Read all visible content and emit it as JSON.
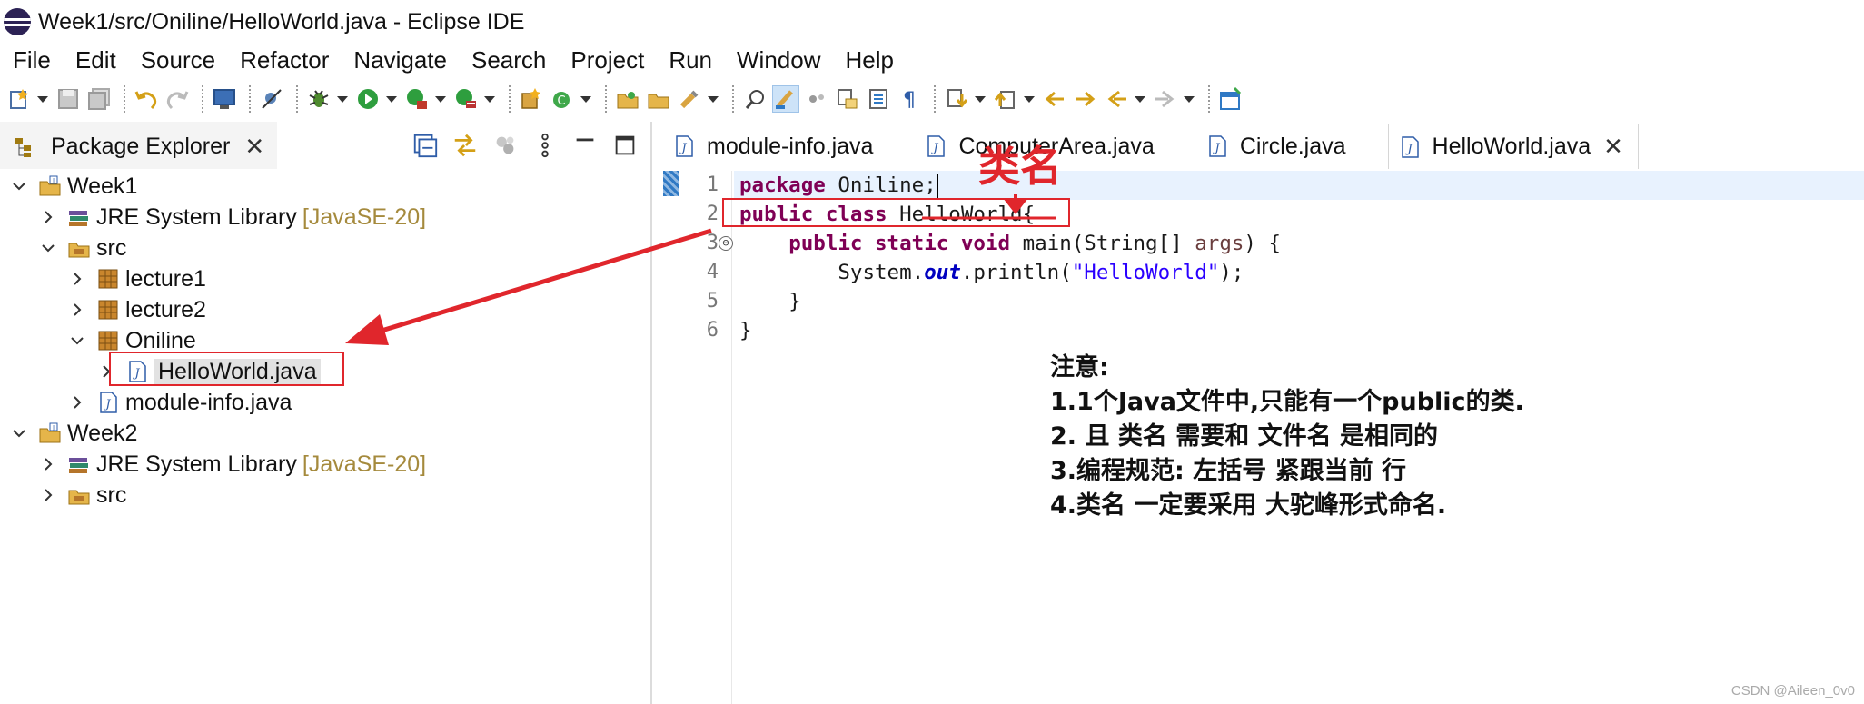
{
  "window": {
    "title": "Week1/src/Oniline/HelloWorld.java - Eclipse IDE"
  },
  "menu": [
    "File",
    "Edit",
    "Source",
    "Refactor",
    "Navigate",
    "Search",
    "Project",
    "Run",
    "Window",
    "Help"
  ],
  "explorer": {
    "title": "Package Explorer",
    "close": "✕",
    "tree": [
      {
        "label": "Week1"
      },
      {
        "label": "JRE System Library",
        "decoration": "[JavaSE-20]"
      },
      {
        "label": "src"
      },
      {
        "label": "lecture1"
      },
      {
        "label": "lecture2"
      },
      {
        "label": "Oniline"
      },
      {
        "label": "HelloWorld.java"
      },
      {
        "label": "module-info.java"
      },
      {
        "label": "Week2"
      },
      {
        "label": "JRE System Library",
        "decoration": "[JavaSE-20]"
      },
      {
        "label": "src"
      }
    ]
  },
  "editor": {
    "tabs": [
      {
        "label": "module-info.java"
      },
      {
        "label": "ComputerArea.java"
      },
      {
        "label": "Circle.java"
      },
      {
        "label": "HelloWorld.java",
        "close": "✕"
      }
    ],
    "line_numbers": [
      "1",
      "2",
      "3",
      "4",
      "5",
      "6"
    ],
    "code": {
      "l1_kw": "package",
      "l1_rest": " Oniline;",
      "l2_kw1": "public",
      "l2_kw2": "class",
      "l2_name": "HelloWorld",
      "l2_rest": "{",
      "l3_kw1": "public",
      "l3_kw2": "static",
      "l3_kw3": "void",
      "l3_mid": " main(String[] ",
      "l3_param": "args",
      "l3_rest": ") {",
      "l4_a": "System.",
      "l4_field": "out",
      "l4_b": ".println(",
      "l4_str": "\"HelloWorld\"",
      "l4_c": ");",
      "l5": "}",
      "l6": "}"
    },
    "fold_marker": "⊖"
  },
  "annotation": {
    "label": "类名",
    "note_title": "注意:",
    "notes": [
      "1.1个Java文件中,只能有一个public的类.",
      "2. 且  类名 需要和 文件名 是相同的",
      "3.编程规范: 左括号 紧跟当前 行",
      "4.类名 一定要采用 大驼峰形式命名."
    ],
    "color": "#e0262c"
  },
  "watermark": "CSDN @Aileen_0v0"
}
